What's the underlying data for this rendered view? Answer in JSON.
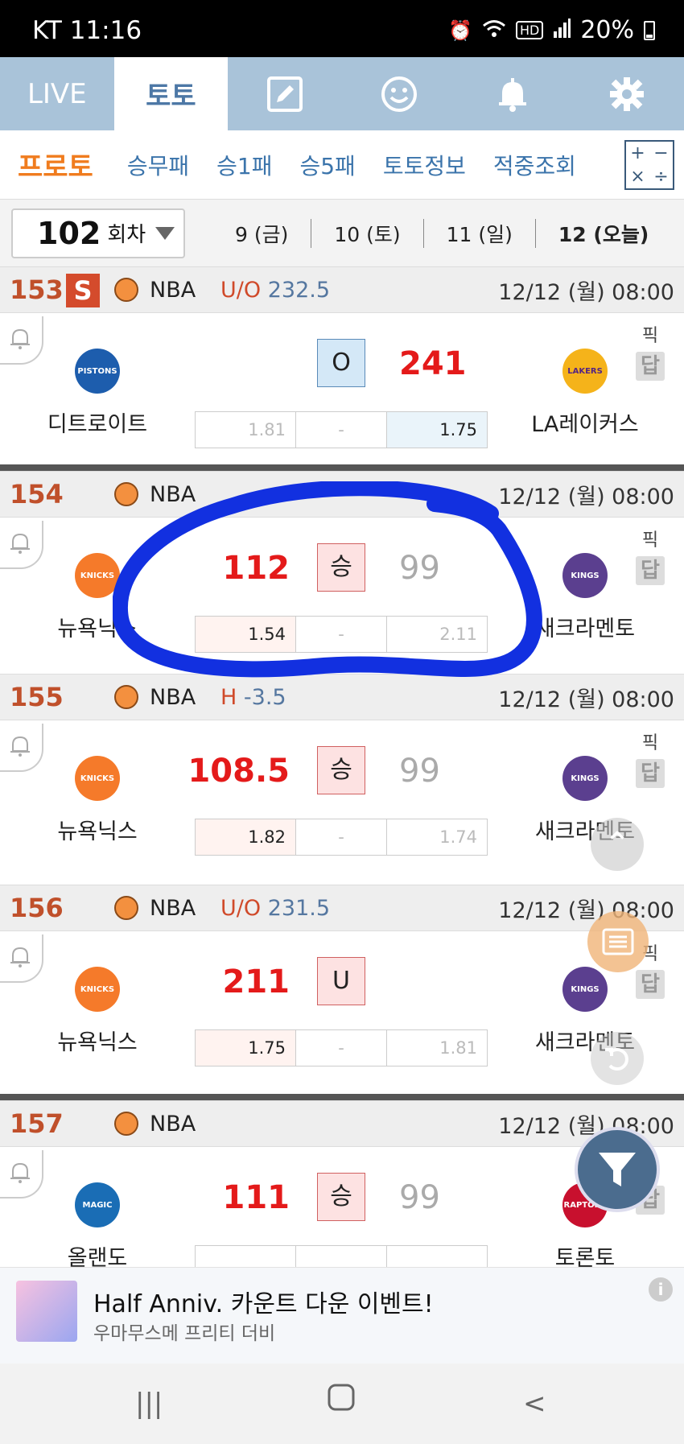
{
  "status_bar": {
    "carrier_time": "KT 11:16",
    "battery": "20%"
  },
  "top_tabs": [
    {
      "label": "LIVE",
      "active": false
    },
    {
      "label": "토토",
      "active": true
    },
    {
      "icon": "edit-icon"
    },
    {
      "icon": "smiley-icon"
    },
    {
      "icon": "bell-icon"
    },
    {
      "icon": "gear-icon"
    }
  ],
  "sub_nav": {
    "items": [
      "프로토",
      "승무패",
      "승1패",
      "승5패",
      "토토정보",
      "적중조회"
    ],
    "calc_symbols": [
      "+",
      "−",
      "×",
      "÷"
    ]
  },
  "round": {
    "number": "102",
    "label": "회차"
  },
  "dates": [
    "9 (금)",
    "10 (토)",
    "11 (일)",
    "12 (오늘)"
  ],
  "games": [
    {
      "num": "153",
      "badge": "S",
      "league": "NBA",
      "ou_label": "U/O",
      "ou_value": "232.5",
      "time": "12/12 (월) 08:00",
      "home": "디트로이트",
      "home_logo": "PISTONS",
      "home_color": "#1d5dad",
      "score_left": "",
      "result": "O",
      "score_right": "241",
      "away": "LA레이커스",
      "away_logo": "LAKERS",
      "away_color": "#f5b31a",
      "odds": [
        "1.81",
        "-",
        "1.75"
      ],
      "pick": "픽",
      "answer": "답"
    },
    {
      "num": "154",
      "badge": "",
      "league": "NBA",
      "ou_label": "",
      "ou_value": "",
      "time": "12/12 (월) 08:00",
      "home": "뉴욕닉스",
      "home_logo": "KNICKS",
      "home_color": "#f57a2a",
      "score_left": "112",
      "result": "승",
      "score_right": "99",
      "away": "새크라멘토",
      "away_logo": "KINGS",
      "away_color": "#5b3f8f",
      "odds": [
        "1.54",
        "-",
        "2.11"
      ],
      "pick": "픽",
      "answer": "답"
    },
    {
      "num": "155",
      "badge": "",
      "league": "NBA",
      "ou_label": "H",
      "ou_value": "-3.5",
      "time": "12/12 (월) 08:00",
      "home": "뉴욕닉스",
      "home_logo": "KNICKS",
      "home_color": "#f57a2a",
      "score_left": "108.5",
      "result": "승",
      "score_right": "99",
      "away": "새크라멘토",
      "away_logo": "KINGS",
      "away_color": "#5b3f8f",
      "odds": [
        "1.82",
        "-",
        "1.74"
      ],
      "pick": "픽",
      "answer": "답"
    },
    {
      "num": "156",
      "badge": "",
      "league": "NBA",
      "ou_label": "U/O",
      "ou_value": "231.5",
      "time": "12/12 (월) 08:00",
      "home": "뉴욕닉스",
      "home_logo": "KNICKS",
      "home_color": "#f57a2a",
      "score_left": "211",
      "result": "U",
      "score_right": "",
      "away": "새크라멘토",
      "away_logo": "KINGS",
      "away_color": "#5b3f8f",
      "odds": [
        "1.75",
        "-",
        "1.81"
      ],
      "pick": "픽",
      "answer": "답"
    },
    {
      "num": "157",
      "badge": "",
      "league": "NBA",
      "ou_label": "",
      "ou_value": "",
      "time": "12/12 (월) 08:00",
      "home": "올랜도",
      "home_logo": "MAGIC",
      "home_color": "#1a6db5",
      "score_left": "111",
      "result": "승",
      "score_right": "99",
      "away": "토론토",
      "away_logo": "RAPTORS",
      "away_color": "#c8102e",
      "odds": [
        "",
        "",
        ""
      ],
      "pick": "픽",
      "answer": "답"
    }
  ],
  "ad": {
    "title": "Half Anniv. 카운트 다운 이벤트!",
    "subtitle": "우마무스메 프리티 더비"
  }
}
